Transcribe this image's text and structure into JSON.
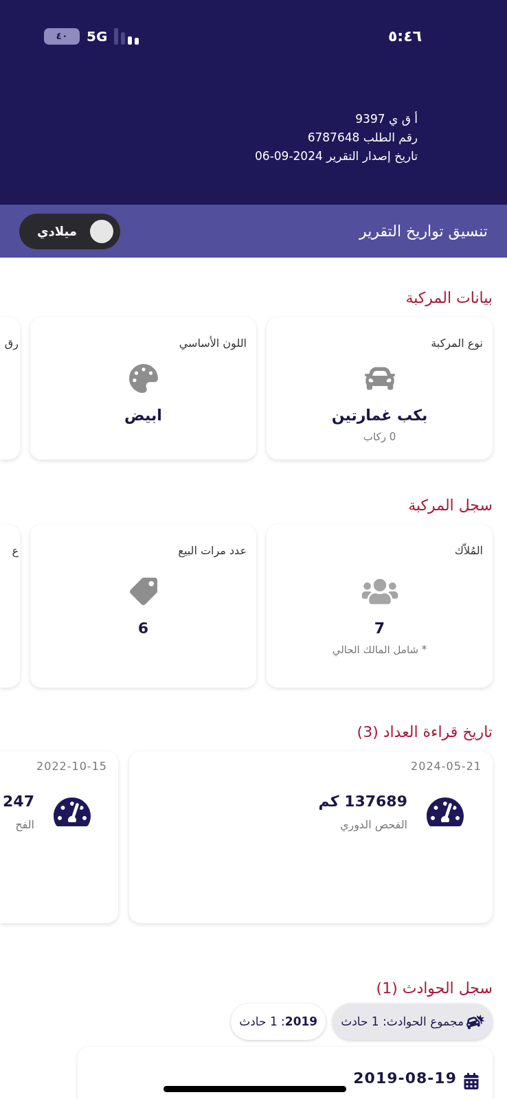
{
  "status_bar": {
    "time": "٥:٤٦",
    "network": "5G",
    "battery": "٤٠"
  },
  "header": {
    "lines": [
      "أ ق ي 9397",
      "رقم الطلب 6787648",
      "تاريخ إصدار التقرير 2024-09-06"
    ]
  },
  "date_format_bar": {
    "title": "تنسيق تواريخ التقرير",
    "toggle": {
      "label": "ميلادي",
      "on": true
    }
  },
  "vehicle_data": {
    "title": "بيانات المركبة",
    "cards": [
      {
        "kind": "car",
        "label": "نوع المركبة",
        "value": "بكب غمارتين",
        "subtitle": "0 ركاب"
      },
      {
        "kind": "palette",
        "label": "اللون الأساسي",
        "value": "ابيض"
      },
      {
        "kind": "cut",
        "label": "رق"
      }
    ]
  },
  "vehicle_history": {
    "title": "سجل المركبة",
    "cards": [
      {
        "kind": "owners",
        "label": "المُلاّك",
        "value": "7",
        "subtitle": "* شامل المالك الحالي"
      },
      {
        "kind": "sales",
        "label": "عدد مرات البيع",
        "value": "6"
      },
      {
        "kind": "cut",
        "label": "ع"
      }
    ]
  },
  "odometer_history": {
    "title": "تاريخ قراءة العداد (3)",
    "readings": [
      {
        "kind": "full",
        "date": "2024-05-21",
        "value": "137689 كم",
        "source": "الفحص الدوري"
      },
      {
        "kind": "cut",
        "date": "2022-10-15",
        "value": "247",
        "source": "الفح"
      }
    ]
  },
  "accidents": {
    "title": "سجل الحوادث (1)",
    "chips": [
      {
        "kind": "total",
        "text": "مجموع الحوادث: 1 حادث",
        "selected": true
      },
      {
        "kind": "year",
        "text": "**2019**: 1 حادث",
        "selected": false
      }
    ],
    "records": [
      {
        "date": "2019-08-19"
      }
    ]
  }
}
